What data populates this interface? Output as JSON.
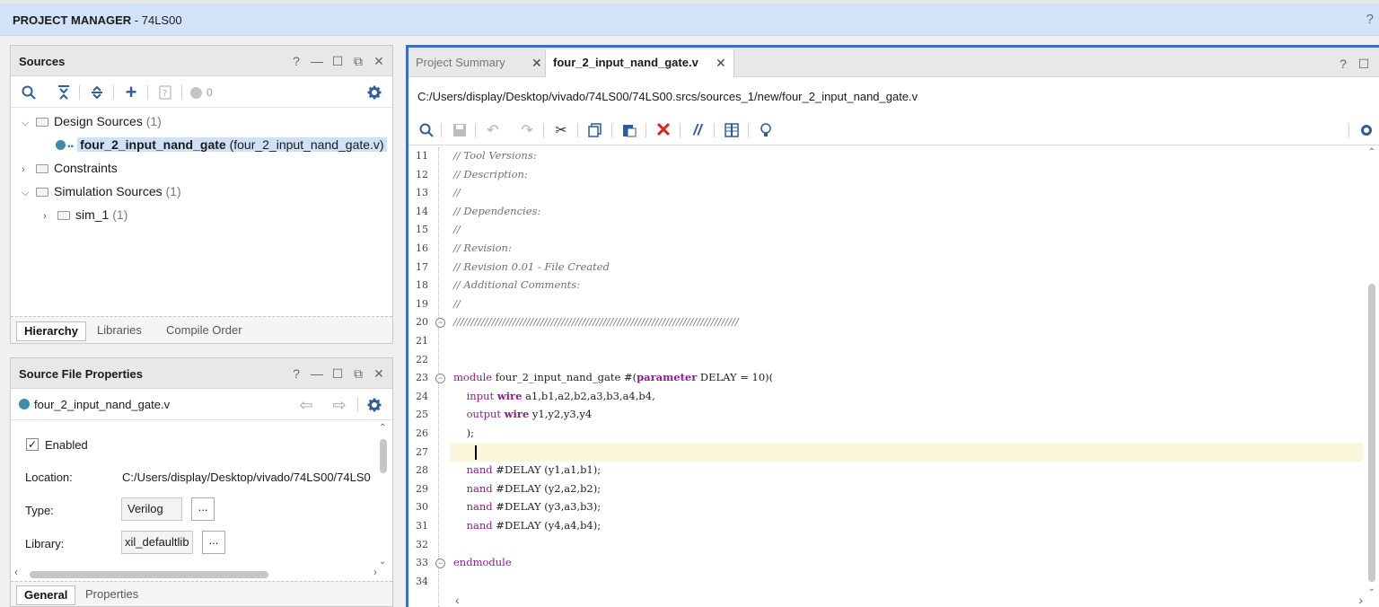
{
  "app": {
    "title_bold": "PROJECT MANAGER",
    "title_rest": " - 74LS00",
    "help": "?"
  },
  "sources": {
    "title": "Sources",
    "win_ctrls": [
      "?",
      "—",
      "☐",
      "⧉",
      "✕"
    ],
    "filter_count": "0",
    "tree": {
      "design_sources": {
        "label": "Design Sources",
        "count": "(1)"
      },
      "file": {
        "name": "four_2_input_nand_gate",
        "file": "(four_2_input_nand_gate.v)"
      },
      "constraints": {
        "label": "Constraints"
      },
      "simulation_sources": {
        "label": "Simulation Sources",
        "count": "(1)"
      },
      "sim": {
        "label": "sim_1",
        "count": "(1)"
      }
    },
    "tabs": [
      "Hierarchy",
      "Libraries",
      "Compile Order"
    ]
  },
  "properties": {
    "title": "Source File Properties",
    "win_ctrls": [
      "?",
      "—",
      "☐",
      "⧉",
      "✕"
    ],
    "file_name": "four_2_input_nand_gate.v",
    "enabled_label": "Enabled",
    "enabled_checked": true,
    "location_label": "Location:",
    "location_value": "C:/Users/display/Desktop/vivado/74LS00/74LS0",
    "type_label": "Type:",
    "type_value": "Verilog",
    "library_label": "Library:",
    "library_value": "xil_defaultlib",
    "browse": "...",
    "tabs": [
      "General",
      "Properties"
    ]
  },
  "editor": {
    "tabs": [
      {
        "label": "Project Summary",
        "active": false
      },
      {
        "label": "four_2_input_nand_gate.v",
        "active": true
      }
    ],
    "close": "✕",
    "path": "C:/Users/display/Desktop/vivado/74LS00/74LS00.srcs/sources_1/new/four_2_input_nand_gate.v",
    "win_ctrls": [
      "?",
      "☐"
    ],
    "lines": [
      {
        "n": "11",
        "text": "// Tool Versions:"
      },
      {
        "n": "12",
        "text": "// Description:"
      },
      {
        "n": "13",
        "text": "//"
      },
      {
        "n": "14",
        "text": "// Dependencies:"
      },
      {
        "n": "15",
        "text": "//"
      },
      {
        "n": "16",
        "text": "// Revision:"
      },
      {
        "n": "17",
        "text": "// Revision 0.01 - File Created"
      },
      {
        "n": "18",
        "text": "// Additional Comments:"
      },
      {
        "n": "19",
        "text": "//"
      },
      {
        "n": "20",
        "text": "//////////////////////////////////////////////////////////////////////////////////"
      },
      {
        "n": "21",
        "text": ""
      },
      {
        "n": "22",
        "text": ""
      },
      {
        "n": "23",
        "text": "module four_2_input_nand_gate #(parameter DELAY = 10)("
      },
      {
        "n": "24",
        "text": "    input wire a1,b1,a2,b2,a3,b3,a4,b4,"
      },
      {
        "n": "25",
        "text": "    output wire y1,y2,y3,y4"
      },
      {
        "n": "26",
        "text": "    );"
      },
      {
        "n": "27",
        "text": ""
      },
      {
        "n": "28",
        "text": "    nand #DELAY (y1,a1,b1);"
      },
      {
        "n": "29",
        "text": "    nand #DELAY (y2,a2,b2);"
      },
      {
        "n": "30",
        "text": "    nand #DELAY (y3,a3,b3);"
      },
      {
        "n": "31",
        "text": "    nand #DELAY (y4,a4,b4);"
      },
      {
        "n": "32",
        "text": ""
      },
      {
        "n": "33",
        "text": "endmodule"
      },
      {
        "n": "34",
        "text": ""
      }
    ]
  }
}
